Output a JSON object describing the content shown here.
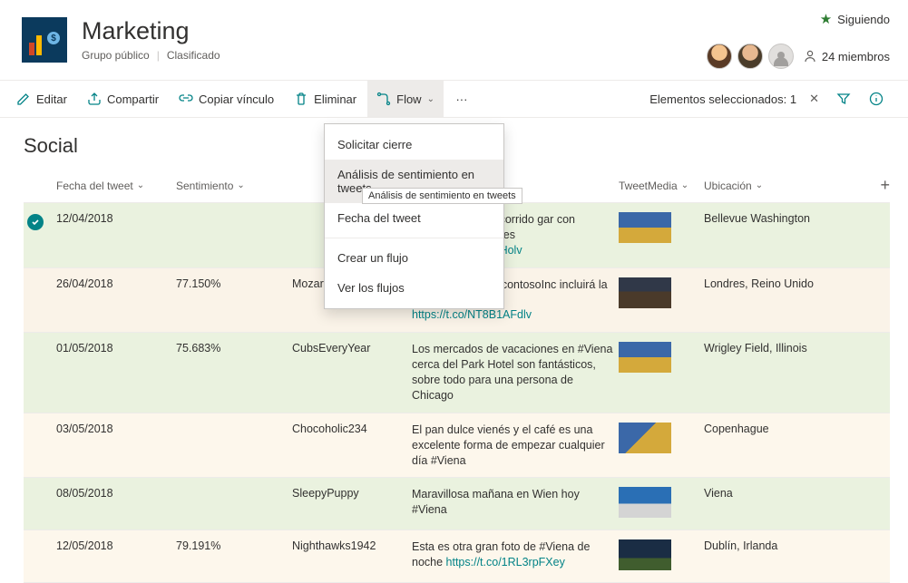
{
  "site": {
    "title": "Marketing",
    "type": "Grupo público",
    "classification": "Clasificado"
  },
  "follow": {
    "label": "Siguiendo"
  },
  "members": {
    "count_label": "24 miembros"
  },
  "toolbar": {
    "edit": "Editar",
    "share": "Compartir",
    "copy_link": "Copiar vínculo",
    "delete": "Eliminar",
    "flow": "Flow",
    "selected_label": "Elementos seleccionados: 1"
  },
  "flow_menu": {
    "items": [
      "Solicitar cierre",
      "Análisis de sentimiento en tweets",
      "Fecha del tweet",
      "Crear un flujo",
      "Ver los flujos"
    ],
    "tooltip": "Análisis de sentimiento en tweets"
  },
  "list": {
    "title": "Social",
    "columns": {
      "date": "Fecha del tweet",
      "sentiment": "Sentimiento",
      "user": "",
      "text": "",
      "media": "TweetMedia",
      "location": "Ubicación"
    },
    "rows": [
      {
        "date": "12/04/2018",
        "sentiment": "",
        "user": "",
        "text_visible": "ance un nuevo recorrido gar con excelente comida es ",
        "link": "https://t.co/IEh28jHolv",
        "location": "Bellevue Washington",
        "thumb": "thumb1",
        "selected": true,
        "style": "selected"
      },
      {
        "date": "26/04/2018",
        "sentiment": "77.150%",
        "user": "MozartFan3458",
        "text_visible": "Me pregunto si @contosoInc incluirá la Ópera de Viena ",
        "link": "https://t.co/NT8B1AFdlv",
        "location": "Londres, Reino Unido",
        "thumb": "thumb2",
        "style": "alt"
      },
      {
        "date": "01/05/2018",
        "sentiment": "75.683%",
        "user": "CubsEveryYear",
        "text_visible": "Los mercados de vacaciones en #Viena cerca del Park Hotel son fantásticos, sobre todo para una persona de Chicago",
        "link": "",
        "location": "Wrigley Field, Illinois",
        "thumb": "thumb3",
        "style": "alt2"
      },
      {
        "date": "03/05/2018",
        "sentiment": "",
        "user": "Chocoholic234",
        "text_visible": "El pan dulce vienés y el café es una excelente forma de empezar cualquier día #Viena",
        "link": "",
        "location": "Copenhague",
        "thumb": "thumb4",
        "style": "alt3"
      },
      {
        "date": "08/05/2018",
        "sentiment": "",
        "user": "SleepyPuppy",
        "text_visible": "Maravillosa mañana en Wien hoy #Viena",
        "link": "",
        "location": "Viena",
        "thumb": "thumb5",
        "style": "alt2"
      },
      {
        "date": "12/05/2018",
        "sentiment": "79.191%",
        "user": "Nighthawks1942",
        "text_visible": "Esta es otra gran foto de #Viena de noche ",
        "link": "https://t.co/1RL3rpFXey",
        "location": "Dublín, Irlanda",
        "thumb": "thumb6",
        "style": "alt3"
      }
    ]
  }
}
